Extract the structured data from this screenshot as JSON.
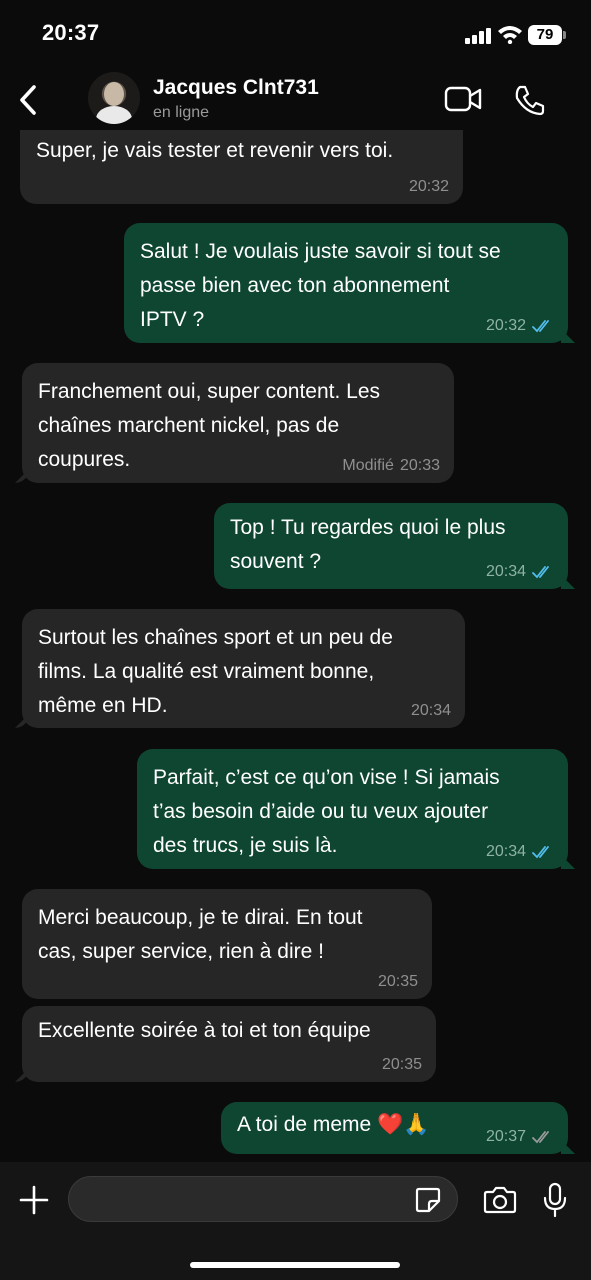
{
  "status_bar": {
    "time": "20:37",
    "battery": "79"
  },
  "header": {
    "contact_name": "Jacques Clnt731",
    "contact_status": "en ligne"
  },
  "messages": [
    {
      "dir": "in",
      "text": "Super, je vais tester et revenir vers toi.",
      "time": "20:32",
      "edited": ""
    },
    {
      "dir": "out",
      "text": "Salut ! Je voulais juste savoir si tout se\npasse bien avec ton abonnement\nIPTV ?",
      "time": "20:32",
      "edited": ""
    },
    {
      "dir": "in",
      "text": "Franchement oui, super content. Les\nchaînes marchent nickel, pas de\ncoupures.",
      "time": "20:33",
      "edited": "Modifié"
    },
    {
      "dir": "out",
      "text": "Top ! Tu regardes quoi le plus\nsouvent ?",
      "time": "20:34",
      "edited": ""
    },
    {
      "dir": "in",
      "text": "Surtout les chaînes sport et un peu de\nfilms. La qualité est vraiment bonne,\nmême en HD.",
      "time": "20:34",
      "edited": ""
    },
    {
      "dir": "out",
      "text": "Parfait, c’est ce qu’on vise ! Si jamais\nt’as besoin d’aide ou tu veux ajouter\ndes trucs, je suis là.",
      "time": "20:34",
      "edited": ""
    },
    {
      "dir": "in",
      "text": "Merci beaucoup, je te dirai. En tout\ncas, super service, rien à dire !",
      "time": "20:35",
      "edited": ""
    },
    {
      "dir": "in",
      "text": "Excellente soirée à toi et ton équipe",
      "time": "20:35",
      "edited": ""
    },
    {
      "dir": "out",
      "text": "A toi de meme ❤️🙏",
      "time": "20:37",
      "edited": ""
    }
  ],
  "colors": {
    "incoming_bubble": "#262626",
    "outgoing_bubble": "#0e4632",
    "read_ticks": "#53bdeb",
    "read_ticks_grey": "#8f8f8f"
  },
  "icons": [
    "back-chevron-icon",
    "video-call-icon",
    "phone-call-icon",
    "plus-icon",
    "sticker-icon",
    "camera-icon",
    "microphone-icon",
    "double-check-icon"
  ]
}
